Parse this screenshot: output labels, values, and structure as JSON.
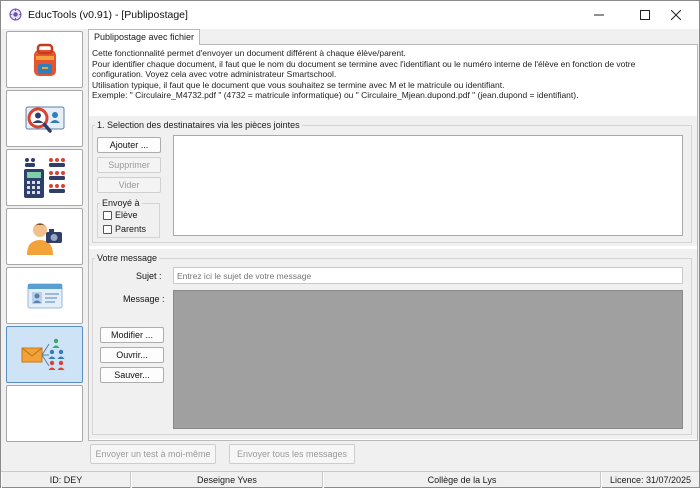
{
  "window": {
    "title": "EducTools (v0.91) - [Publipostage]",
    "controls": [
      "minimize",
      "maximize",
      "close"
    ]
  },
  "nav": {
    "items": [
      {
        "icon": "backpack-icon"
      },
      {
        "icon": "search-person-icon"
      },
      {
        "icon": "calculator-people-icon"
      },
      {
        "icon": "person-camera-icon"
      },
      {
        "icon": "id-card-icon"
      },
      {
        "icon": "mail-people-icon",
        "active": true
      },
      {
        "icon": ""
      }
    ]
  },
  "tab": {
    "label": "Publipostage avec fichier"
  },
  "info": {
    "lines": [
      "Cette fonctionnalité permet d'envoyer un document différent à chaque élève/parent.",
      "Pour identifier chaque document, il faut que le nom du document se termine avec l'identifiant ou le numéro interne de l'élève en fonction de votre",
      "configuration. Voyez cela avec votre administrateur Smartschool.",
      "Utilisation typique, il faut que le document que vous souhaitez se termine avec M et le matricule ou identifiant.",
      "Exemple: \" Circulaire_M4732.pdf \" (4732 = matricule informatique) ou \" Circulaire_Mjean.dupond.pdf \" (jean.dupond = identifiant)."
    ]
  },
  "recipients": {
    "title": "1. Selection des destinataires via les pièces jointes",
    "add_label": "Ajouter ...",
    "remove_label": "Supprimer",
    "clear_label": "Vider",
    "sent_to_title": "Envoyé à",
    "student_label": "Elève",
    "parents_label": "Parents"
  },
  "message": {
    "title": "Votre message",
    "subject_label": "Sujet :",
    "subject_placeholder": "Entrez ici le sujet de votre message",
    "message_label": "Message :",
    "modify_label": "Modifier ...",
    "open_label": "Ouvrir...",
    "save_label": "Sauver..."
  },
  "actions": {
    "send_test_label": "Envoyer un test à moi-même",
    "send_all_label": "Envoyer tous les messages"
  },
  "status": {
    "id": "ID: DEY",
    "user": "Deseigne Yves",
    "school": "Collège de la Lys",
    "license": "Licence: 31/07/2025"
  }
}
